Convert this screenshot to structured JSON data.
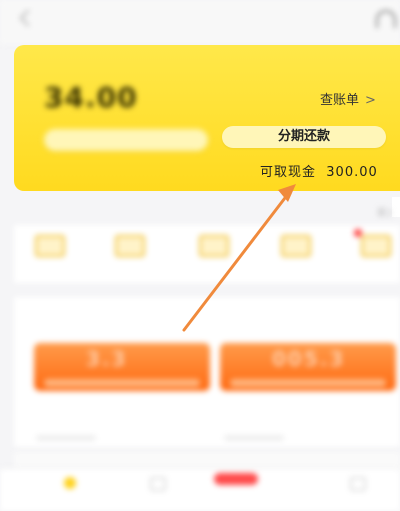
{
  "header": {
    "title": "",
    "subtitle": "",
    "back_icon": "chevron-left-icon",
    "service_icon": "headset-icon"
  },
  "card": {
    "top_label": "",
    "amount": "34.00",
    "bill_label": "查账单",
    "bill_chevron": ">",
    "left_button": "",
    "installment_button": "分期还款",
    "bottom_left_text": "",
    "cash_label": "可取现金",
    "cash_amount": "300.00",
    "accent": "#ffdf2e"
  },
  "side_strip": "区 J",
  "shortcuts": [
    {
      "label": "",
      "icon": "card-icon"
    },
    {
      "label": "",
      "icon": "card-icon"
    },
    {
      "label": "",
      "icon": "card-icon"
    },
    {
      "label": "",
      "icon": "card-icon"
    },
    {
      "label": "",
      "icon": "card-icon",
      "badge": true
    }
  ],
  "promo": {
    "title": "",
    "more": "",
    "coupons": [
      {
        "value": "3.3"
      },
      {
        "value": "005.3"
      }
    ]
  },
  "tabs": [
    {
      "label": ""
    },
    {
      "label": ""
    },
    {
      "label": ""
    },
    {
      "label": ""
    }
  ],
  "annotation": {
    "arrow_color": "#f08a3c"
  }
}
